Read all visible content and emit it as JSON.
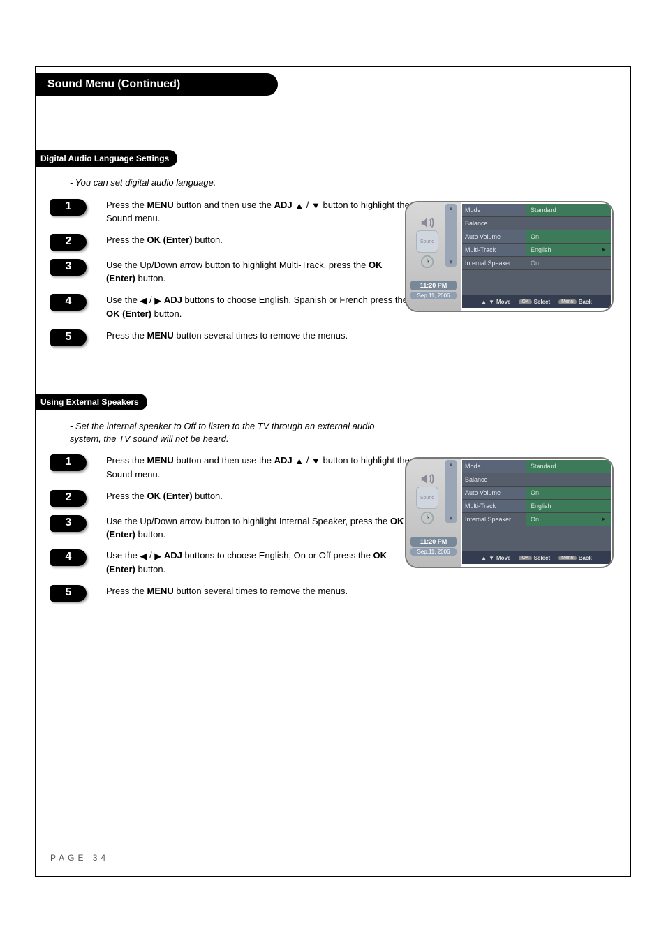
{
  "header": {
    "title": "Sound Menu (Continued)"
  },
  "page_label": "PAGE 34",
  "arrows": {
    "up": "▲",
    "down": "▼",
    "left": "◀",
    "right": "▶",
    "slash": " / "
  },
  "section1": {
    "title": "Digital Audio Language Settings",
    "note": "- You can set digital audio language.",
    "steps": [
      {
        "n": "1",
        "pre": "Press the ",
        "b1": "MENU",
        "mid1": " button and then use the ",
        "b2": "ADJ",
        "mid2": " button to highlight the Sound menu.",
        "uses_updown_arrows": true
      },
      {
        "n": "2",
        "pre": "Press the ",
        "b1": "OK (Enter)",
        "mid1": " button."
      },
      {
        "n": "3",
        "pre": "Use the Up/Down arrow button to highlight Multi-Track, press the ",
        "b1": "OK (Enter)",
        "mid1": " button."
      },
      {
        "n": "4",
        "pre": "Use the ",
        "arrows_lr": true,
        "b1": "ADJ",
        "mid1": " buttons to choose English, Spanish or French press the ",
        "b2": "OK (Enter)",
        "mid2": " button."
      },
      {
        "n": "5",
        "pre": "Press the ",
        "b1": "MENU",
        "mid1": " button several times to remove the menus."
      }
    ]
  },
  "section2": {
    "title": "Using External Speakers",
    "note": "- Set the internal speaker to Off to listen to the TV through an external audio system, the TV sound will not be heard.",
    "steps": [
      {
        "n": "1",
        "pre": "Press the ",
        "b1": "MENU",
        "mid1": " button and then use the ",
        "b2": "ADJ",
        "mid2": " button to highlight the Sound menu.",
        "uses_updown_arrows": true
      },
      {
        "n": "2",
        "pre": "Press the ",
        "b1": "OK (Enter)",
        "mid1": " button."
      },
      {
        "n": "3",
        "pre": "Use the Up/Down arrow button to highlight Internal Speaker, press the ",
        "b1": "OK (Enter)",
        "mid1": " button."
      },
      {
        "n": "4",
        "pre": "Use the ",
        "arrows_lr": true,
        "b1": "ADJ",
        "mid1": " buttons to choose English, On or Off press the ",
        "b2": "OK (Enter)",
        "mid2": " button."
      },
      {
        "n": "5",
        "pre": "Press the ",
        "b1": "MENU",
        "mid1": " button several times to remove the menus."
      }
    ]
  },
  "osd": {
    "side_icon_label": "Sound",
    "time": "11:20 PM",
    "date": "Sep.11, 2006",
    "rows": [
      {
        "label": "Mode",
        "value": "Standard"
      },
      {
        "label": "Balance",
        "value": ""
      },
      {
        "label": "Auto Volume",
        "value": "On"
      },
      {
        "label": "Multi-Track",
        "value": "English"
      },
      {
        "label": "Internal Speaker",
        "value": "On"
      }
    ],
    "highlight_index_a": 3,
    "highlight_index_b": 4,
    "bottom": {
      "move": "Move",
      "ok": "OK",
      "select": "Select",
      "menu": "Menu",
      "back": "Back"
    }
  }
}
